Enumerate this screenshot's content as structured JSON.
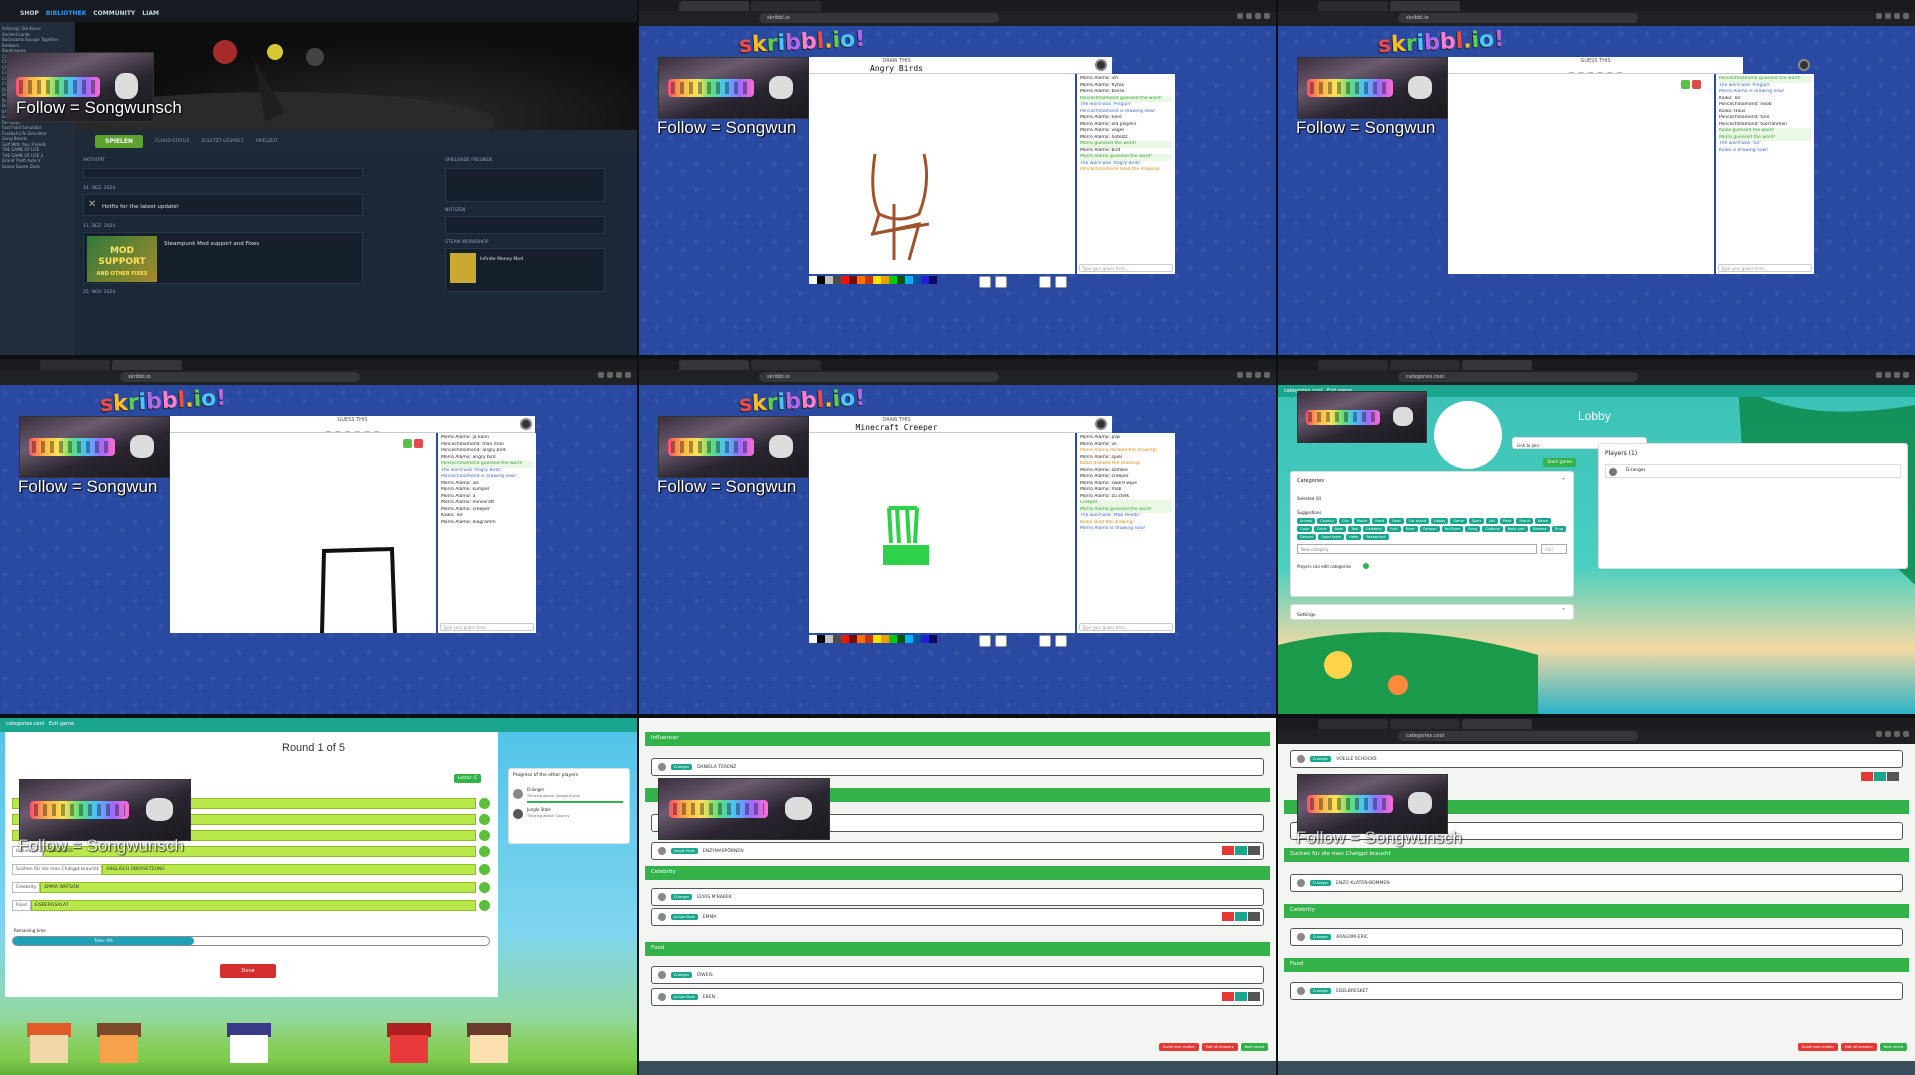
{
  "overlay": {
    "follow_text": "Follow = Songwunsch",
    "follow_short": "Follow = Songwun"
  },
  "steam": {
    "nav": [
      "SHOP",
      "BIBLIOTHEK",
      "COMMUNITY",
      "LIAM"
    ],
    "play_label": "SPIELEN",
    "stats": [
      "CLOUD-STATUS",
      "ZULETZT GESPIELT",
      "SPIELZEIT"
    ],
    "section_activity": "AKTIVITÄT",
    "section_friends": "SPIELENDE FREUNDE",
    "section_notes": "NOTIZEN",
    "section_workshop": "STEAM WORKSHOP",
    "date1": "14. DEZ. 2024",
    "date2": "11. DEZ. 2024",
    "date3": "25. NOV. 2024",
    "patch_title": "Hotfix for the latest update!",
    "news_title": "Steampunk Mod support and Fixes",
    "mod_banner": "MOD SUPPORT",
    "mod_banner_sub": "AND OTHER FIXES",
    "workshop_item": "Infinite Money Mod",
    "sidebar": [
      "Achtung! Die Kurve",
      "Ancient Lands",
      "Backrooms Escape Together",
      "Bedwars",
      "Barotrauma",
      "Castle Crashers",
      "Chained Together",
      "Chivalry 2",
      "Content Warning",
      "Cooking Simulator",
      "Crab Game",
      "Dead by Daylight",
      "Deep Rock Galactic",
      "Don't Starve Together",
      "Drive Beyond Horizons",
      "EA SPORTS FC 25",
      "Euro Truck Simulator 2",
      "Fall Guys",
      "Fast Food Simulator",
      "Football Life Simulator",
      "Gang Beasts",
      "Golf With Your Friends",
      "THE GAME OF LIFE",
      "THE GAME OF LIFE 2",
      "Grand Theft Auto V",
      "Goose Goose Duck"
    ]
  },
  "skribbl": {
    "hint": "DRAW THIS",
    "guess_hint": "GUESS THIS",
    "word_angry": "Angry Birds",
    "word_creeper": "Minecraft Creeper",
    "word_blank": "_ _ _ _ _ _",
    "input_placeholder": "Type your guess here...",
    "chat_a": [
      {
        "t": "Morro Alamo: ich",
        "c": ""
      },
      {
        "t": "Morro Alamo: flyfox",
        "c": ""
      },
      {
        "t": "Morro Alamo: bosso",
        "c": ""
      },
      {
        "t": "Poncechdiamond guessed the word!",
        "c": "g"
      },
      {
        "t": "The word was 'Pinguin'",
        "c": "b"
      },
      {
        "t": "Poncechdiamond is drawing now!",
        "c": "b"
      },
      {
        "t": "Morro Alamo: tiere",
        "c": ""
      },
      {
        "t": "Morro Alamo: old players",
        "c": ""
      },
      {
        "t": "Morro Alamo: vogel",
        "c": ""
      },
      {
        "t": "Morro Alamo: hotelzz",
        "c": ""
      },
      {
        "t": "Morro guessed the word!",
        "c": "g"
      },
      {
        "t": "Morro Alamo: bird",
        "c": ""
      },
      {
        "t": "Morro Alamo guessed the word!",
        "c": "g"
      },
      {
        "t": "The word was 'Angry Birds'",
        "c": "b"
      },
      {
        "t": "Poncechdiamond liked the drawing!",
        "c": "o"
      }
    ],
    "chat_b": [
      {
        "t": "Poncechdiamond guessed the word!",
        "c": "g"
      },
      {
        "t": "The word was 'Pinguin'",
        "c": "b"
      },
      {
        "t": "Morro Alamo is drawing now!",
        "c": "b"
      },
      {
        "t": "Kaiko: Tor",
        "c": ""
      },
      {
        "t": "Poncechdiamond: noob",
        "c": ""
      },
      {
        "t": "Kaiko: Haus",
        "c": ""
      },
      {
        "t": "Poncechdiamond: tore",
        "c": ""
      },
      {
        "t": "Poncechdiamond: tuerrahmen",
        "c": ""
      },
      {
        "t": "Kaiko guessed the word!",
        "c": "g"
      },
      {
        "t": "Morro guessed the word!",
        "c": "g"
      },
      {
        "t": "The word was 'Tür'",
        "c": "b"
      },
      {
        "t": "Kaiko is drawing now!",
        "c": "b"
      }
    ],
    "chat_c": [
      {
        "t": "Morro Alamo: ja kann",
        "c": ""
      },
      {
        "t": "Poncechdiamond: man man",
        "c": ""
      },
      {
        "t": "Poncechdiamond: angry bird",
        "c": ""
      },
      {
        "t": "Morro Alamo: angry bird",
        "c": ""
      },
      {
        "t": "Poncechdiamond guessed the word!",
        "c": "g"
      },
      {
        "t": "The word was 'Angry Birds'",
        "c": "b"
      },
      {
        "t": "Poncechdiamond is drawing now!",
        "c": "b"
      },
      {
        "t": "Morro Alamo: ios",
        "c": ""
      },
      {
        "t": "Morro Alamo: kumpel",
        "c": ""
      },
      {
        "t": "Morro Alamo: a",
        "c": ""
      },
      {
        "t": "Morro Alamo: minecraft",
        "c": ""
      },
      {
        "t": "Morro Alamo: creeper",
        "c": ""
      },
      {
        "t": "Kaiko: Tor",
        "c": ""
      },
      {
        "t": "Morro Alamo: diagramm",
        "c": ""
      }
    ],
    "chat_d": [
      {
        "t": "Morro Alamo: pvp",
        "c": ""
      },
      {
        "t": "Morro Alamo: vs",
        "c": ""
      },
      {
        "t": "Morro Alamo disliked the drawing!",
        "c": "o"
      },
      {
        "t": "Morro Alamo: spiel",
        "c": ""
      },
      {
        "t": "Kaiko disliked the drawing!",
        "c": "o"
      },
      {
        "t": "Morro Alamo: zombie",
        "c": ""
      },
      {
        "t": "Morro Alamo: creeper",
        "c": ""
      },
      {
        "t": "Morro Alamo: sword wipe",
        "c": ""
      },
      {
        "t": "Morro Alamo: mob",
        "c": ""
      },
      {
        "t": "Morro Alamo: zu stefk",
        "c": ""
      },
      {
        "t": "Creeper",
        "c": "g"
      },
      {
        "t": "Morro Alamo guessed the word!",
        "c": "g"
      },
      {
        "t": "The word was 'Mob Heads'",
        "c": "b"
      },
      {
        "t": "Kaiko liked the drawing!",
        "c": "o"
      },
      {
        "t": "Morro Alamo is drawing now!",
        "c": "b"
      }
    ]
  },
  "categories": {
    "site": "categories.cool",
    "exit": "Exit game",
    "lobby_title": "Lobby",
    "link_label": "Link to join:",
    "start_label": "Start game",
    "players_label": "Players (1)",
    "player_name": "D-langer",
    "categories_label": "Categories",
    "selected_label": "Selected (0)",
    "suggestion_label": "Suggestions",
    "chips": [
      "Animal",
      "Country",
      "City",
      "Movie",
      "Band",
      "Food",
      "Car brand",
      "Hobby",
      "Game",
      "Sport",
      "Job",
      "Plant",
      "Brand",
      "Name",
      "Color",
      "Drink",
      "Book",
      "Tool",
      "Celebrity",
      "Fruit",
      "River",
      "Cartoon",
      "YouTuber",
      "Song",
      "Clothing",
      "Body part",
      "Disease",
      "Drug",
      "Dessert",
      "Sport team",
      "Hotel",
      "Restaurant"
    ],
    "new_category_placeholder": "New category",
    "add_label": "Add",
    "all_categories_label": "Players can edit categories",
    "settings_label": "Settings",
    "round_title": "Round 1 of 5",
    "letter_label": "Letter: E",
    "progress_title": "Progress of the other players",
    "progress_players": [
      {
        "name": "D-langer",
        "status": "Thinking about: Google-Suche"
      },
      {
        "name": "Jungle Stole",
        "status": "Thinking about: Country"
      }
    ],
    "fields": [
      {
        "label": "Influencer",
        "value": "ANGIERUSS"
      },
      {
        "label": "Suchen für die man Chatgpt braucht",
        "value": "ENGLISCH ÜBERSETZUNG"
      },
      {
        "label": "Celebrity",
        "value": "EMMA WATSON"
      },
      {
        "label": "Food",
        "value": "EISBERGSALAT"
      }
    ],
    "remaining_label": "Remaining time",
    "remaining_value": "Time: 0%",
    "remaining_fraction": 0.38,
    "done_label": "Done"
  },
  "results": {
    "sections": [
      "Influencer",
      "Celebrity",
      "Food"
    ],
    "p1": "D-langer",
    "p2": "Jungle Stole",
    "ans_influencer_1": "DANIELA TERENZ",
    "ans_influencer_2": "ENZYMASPÖRNEN",
    "ans_celebrity_1": "ELYAS M'BAREK",
    "ans_celebrity_2": "EMMA",
    "ans_food_1": "EIWEIS",
    "ans_food_2": "EBEN",
    "ans_b_1": "VOELLE SCHOCKS",
    "ans_b_2": "ENZO KLATEN-BOMMEN",
    "ans_b_3": "ARAGOM-ERIC",
    "ans_b_4": "EDELBRESKET",
    "chatgpt_label": "Suchen für die man Chatgpt braucht",
    "foot": [
      "Guide new chatter",
      "Edit all answers",
      "Next round"
    ]
  },
  "colors": {
    "skribbl_blue": "#2a4aa2",
    "steam_green": "#5ba32b",
    "categories_teal": "#1aa58f",
    "categories_green": "#33b249"
  }
}
